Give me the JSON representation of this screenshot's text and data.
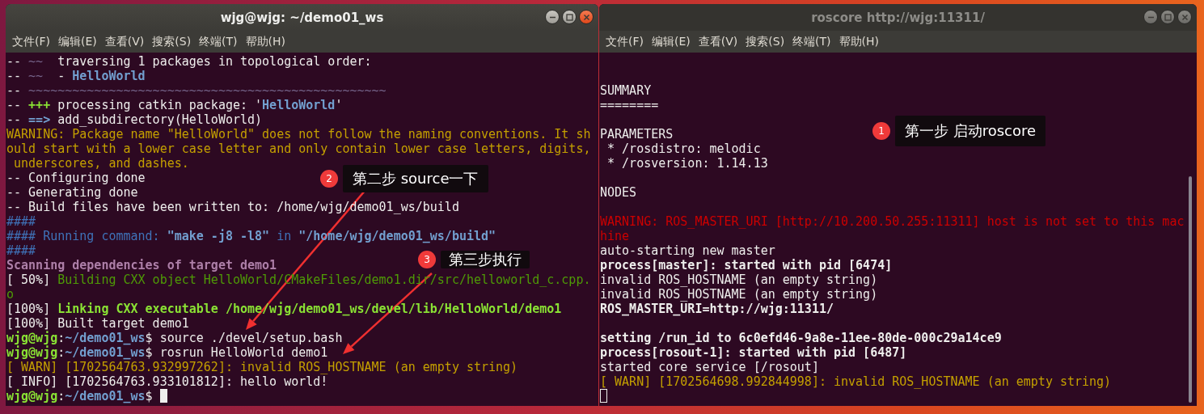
{
  "windows": [
    {
      "title": "wjg@wjg: ~/demo01_ws",
      "focused": true,
      "menu": [
        "文件(F)",
        "编辑(E)",
        "查看(V)",
        "搜索(S)",
        "终端(T)",
        "帮助(H)"
      ],
      "blocks": [
        [
          [
            {
              "text": "-- ",
              "kind": "plain"
            },
            {
              "text": "~~",
              "kind": "dim"
            },
            {
              "text": "  traversing 1 packages in topological order:",
              "kind": "plain"
            }
          ],
          [
            {
              "text": "-- ",
              "kind": "plain"
            },
            {
              "text": "~~",
              "kind": "dim"
            },
            {
              "text": "  - ",
              "kind": "plain"
            },
            {
              "text": "HelloWorld",
              "kind": "blue-bold"
            }
          ],
          [
            {
              "text": "-- ",
              "kind": "plain"
            },
            {
              "text": "~~~~~~~~~~~~~~~~~~~~~~~~~~~~~~~~~~~~~~~~~~~~~~~~~",
              "kind": "dim"
            }
          ],
          [
            {
              "text": "-- ",
              "kind": "plain"
            },
            {
              "text": "+++",
              "kind": "green-bold"
            },
            {
              "text": " processing catkin package: '",
              "kind": "plain"
            },
            {
              "text": "HelloWorld",
              "kind": "blue-bold"
            },
            {
              "text": "'",
              "kind": "plain"
            }
          ],
          [
            {
              "text": "-- ",
              "kind": "plain"
            },
            {
              "text": "==>",
              "kind": "blue-bold"
            },
            {
              "text": " add_subdirectory(HelloWorld)",
              "kind": "plain"
            }
          ],
          [
            {
              "text": "WARNING: Package name \"HelloWorld\" does not follow the naming conventions. It sh",
              "kind": "yellow"
            }
          ],
          [
            {
              "text": "ould start with a lower case letter and only contain lower case letters, digits,",
              "kind": "yellow"
            }
          ],
          [
            {
              "text": " underscores, and dashes.",
              "kind": "yellow"
            }
          ],
          [
            {
              "text": "-- Configuring done",
              "kind": "plain"
            }
          ],
          [
            {
              "text": "-- Generating done",
              "kind": "plain"
            }
          ],
          [
            {
              "text": "-- Build files have been written to: /home/wjg/demo01_ws/build",
              "kind": "plain"
            }
          ],
          [
            {
              "text": "####",
              "kind": "blue"
            }
          ],
          [
            {
              "text": "#### Running command: ",
              "kind": "blue"
            },
            {
              "text": "\"make -j8 -l8\"",
              "kind": "blue-bold"
            },
            {
              "text": " in ",
              "kind": "blue"
            },
            {
              "text": "\"/home/wjg/demo01_ws/build\"",
              "kind": "blue-bold"
            }
          ],
          [
            {
              "text": "####",
              "kind": "blue"
            }
          ],
          [
            {
              "text": "Scanning dependencies of target demo1",
              "kind": "purple-bold"
            }
          ],
          [
            {
              "text": "[ 50%] ",
              "kind": "plain"
            },
            {
              "text": "Building CXX object HelloWorld/CMakeFiles/demo1.dir/src/helloworld_c.cpp.",
              "kind": "green"
            }
          ],
          [
            {
              "text": "o",
              "kind": "green"
            }
          ],
          [
            {
              "text": "[100%] ",
              "kind": "plain"
            },
            {
              "text": "Linking CXX executable /home/wjg/demo01_ws/devel/lib/HelloWorld/demo1",
              "kind": "green-bold"
            }
          ],
          [
            {
              "text": "[100%] Built target demo1",
              "kind": "plain"
            }
          ],
          [
            {
              "text": "wjg@wjg",
              "kind": "green-bold"
            },
            {
              "text": ":",
              "kind": "plain"
            },
            {
              "text": "~/demo01_ws",
              "kind": "blue-bold"
            },
            {
              "text": "$ source ./devel/setup.bash",
              "kind": "plain"
            }
          ],
          [
            {
              "text": "wjg@wjg",
              "kind": "green-bold"
            },
            {
              "text": ":",
              "kind": "plain"
            },
            {
              "text": "~/demo01_ws",
              "kind": "blue-bold"
            },
            {
              "text": "$ rosrun HelloWorld demo1",
              "kind": "plain"
            }
          ],
          [
            {
              "text": "[ WARN] [1702564763.932997262]: invalid ROS_HOSTNAME (an empty string)",
              "kind": "yellow"
            }
          ],
          [
            {
              "text": "[ INFO] [1702564763.933101812]: hello world!",
              "kind": "plain"
            }
          ],
          [
            {
              "text": "wjg@wjg",
              "kind": "green-bold"
            },
            {
              "text": ":",
              "kind": "plain"
            },
            {
              "text": "~/demo01_ws",
              "kind": "blue-bold"
            },
            {
              "text": "$ ",
              "kind": "plain"
            },
            {
              "kind": "cursor"
            }
          ]
        ]
      ],
      "annotations": [
        {
          "number": "2",
          "text": "第二步 source一下",
          "kind": "arrowed"
        },
        {
          "number": "3",
          "text": "第三步执行",
          "kind": "arrowed"
        }
      ]
    },
    {
      "title": "roscore http://wjg:11311/",
      "focused": false,
      "menu": [
        "文件(F)",
        "编辑(E)",
        "查看(V)",
        "搜索(S)",
        "终端(T)",
        "帮助(H)"
      ],
      "blocks": [
        [
          [
            {
              "text": "SUMMARY",
              "kind": "plain"
            }
          ],
          [
            {
              "text": "========",
              "kind": "plain"
            }
          ]
        ],
        [
          [
            {
              "text": "PARAMETERS",
              "kind": "plain"
            }
          ],
          [
            {
              "text": " * /rosdistro: melodic",
              "kind": "plain"
            }
          ],
          [
            {
              "text": " * /rosversion: 1.14.13",
              "kind": "plain"
            }
          ]
        ],
        [
          [
            {
              "text": "NODES",
              "kind": "plain"
            }
          ]
        ],
        [
          [
            {
              "text": "WARNING: ROS_MASTER_URI [http://10.200.50.255:11311] host is not set to this mac",
              "kind": "red"
            }
          ],
          [
            {
              "text": "hine",
              "kind": "red"
            }
          ],
          [
            {
              "text": "auto-starting new master",
              "kind": "plain"
            }
          ],
          [
            {
              "text": "process[master]: started with pid [6474]",
              "kind": "bold"
            }
          ],
          [
            {
              "text": "invalid ROS_HOSTNAME (an empty string)",
              "kind": "plain"
            }
          ],
          [
            {
              "text": "invalid ROS_HOSTNAME (an empty string)",
              "kind": "plain"
            }
          ],
          [
            {
              "text": "ROS_MASTER_URI=http://wjg:11311/",
              "kind": "bold"
            }
          ]
        ],
        [
          [
            {
              "text": "setting /run_id to 6c0efd46-9a8e-11ee-80de-000c29a14ce9",
              "kind": "bold"
            }
          ],
          [
            {
              "text": "process[rosout-1]: started with pid [6487]",
              "kind": "bold"
            }
          ],
          [
            {
              "text": "started core service [/rosout]",
              "kind": "plain"
            }
          ],
          [
            {
              "text": "[ WARN] [1702564698.992844998]: invalid ROS_HOSTNAME (an empty string)",
              "kind": "yellow"
            }
          ],
          [
            {
              "kind": "cursor"
            }
          ]
        ]
      ],
      "annotations": [
        {
          "number": "1",
          "text": "第一步 启动roscore",
          "kind": "plain"
        }
      ]
    }
  ]
}
